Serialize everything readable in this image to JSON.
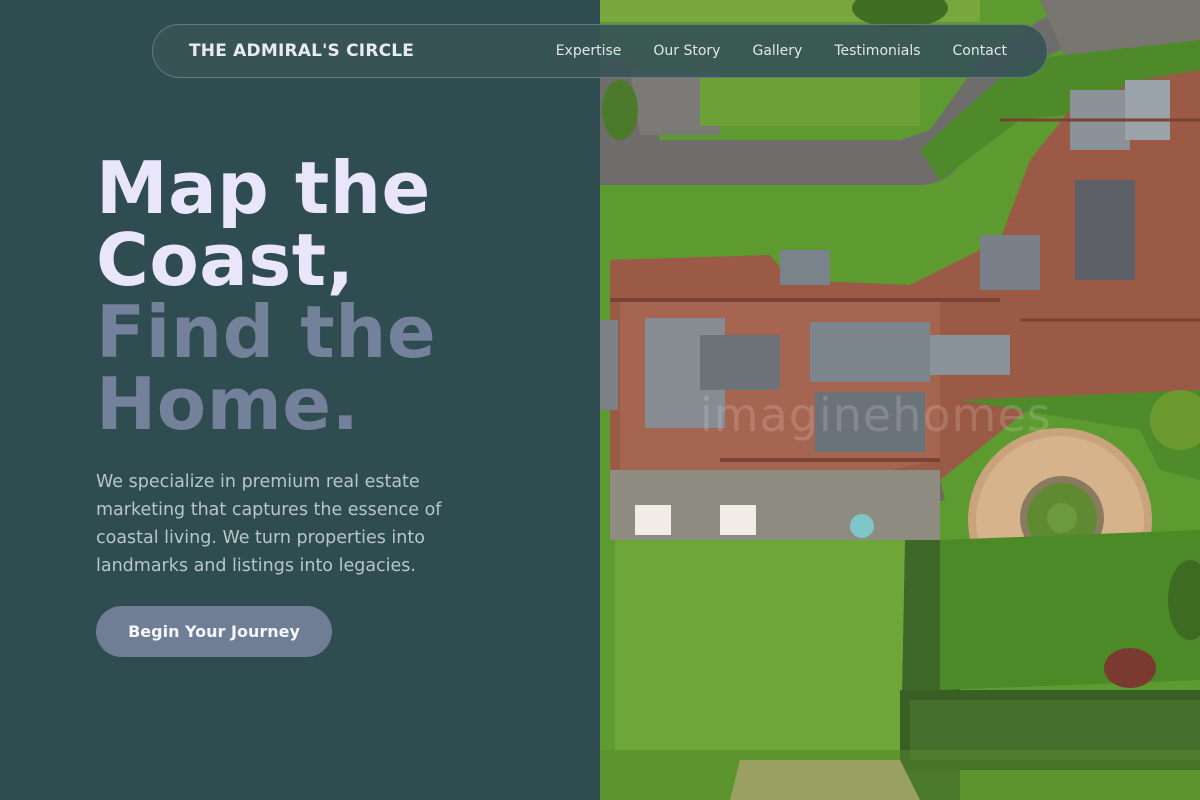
{
  "nav": {
    "brand": "THE ADMIRAL'S CIRCLE",
    "links": [
      "Expertise",
      "Our Story",
      "Gallery",
      "Testimonials",
      "Contact"
    ]
  },
  "hero": {
    "title_line1": "Map the",
    "title_line2": "Coast,",
    "title_line3": "Find the",
    "title_line4": "Home.",
    "description": "We specialize in premium real estate marketing that captures the essence of coastal living. We turn properties into landmarks and listings into legacies.",
    "cta_label": "Begin Your Journey"
  },
  "image": {
    "watermark": "imaginehomes",
    "subject": "aerial view of historic manor house with lawns and circular garden"
  },
  "colors": {
    "panel_bg": "#2f4c50",
    "title_light": "#e9e6fb",
    "title_muted": "#74819a",
    "cta_bg": "#6f7e94"
  }
}
